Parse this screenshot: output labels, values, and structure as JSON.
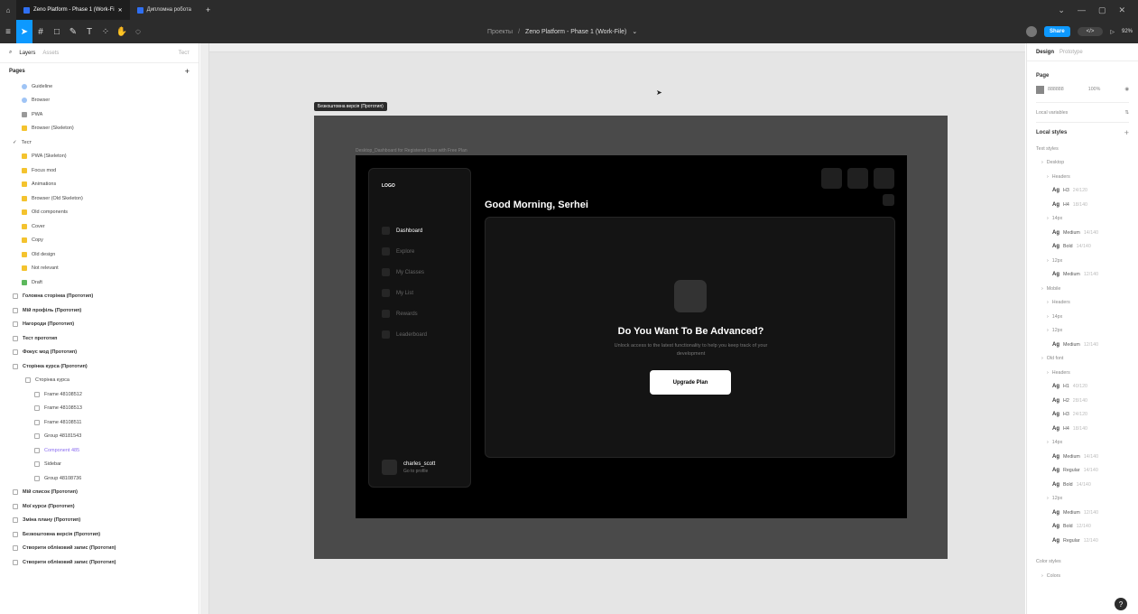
{
  "tabs": [
    "Zeno Platform - Phase 1 (Work-Fi",
    "Дипломна робота"
  ],
  "toolbar": {
    "breadcrumb_root": "Проекты",
    "breadcrumb_sep": "/",
    "file_name": "Zeno Platform - Phase 1 (Work-File)",
    "share": "Share",
    "zoom": "92%"
  },
  "left_panel": {
    "tab_layers": "Layers",
    "tab_assets": "Assets",
    "page_name": "Тест",
    "pages_title": "Pages",
    "add": "+",
    "items": [
      {
        "label": "Guideline",
        "icon": "blue"
      },
      {
        "label": "Browser",
        "icon": "blue"
      },
      {
        "label": "PWA",
        "icon": "gray"
      },
      {
        "label": "Browser (Skeleton)",
        "icon": "folder"
      },
      {
        "label": "Тест",
        "icon": "check"
      },
      {
        "label": "PWA (Skeleton)",
        "icon": "folder"
      },
      {
        "label": "Focus mod",
        "icon": "folder"
      },
      {
        "label": "Animations",
        "icon": "folder"
      },
      {
        "label": "Browser (Old Skeleton)",
        "icon": "folder"
      },
      {
        "label": "Old components",
        "icon": "folder"
      },
      {
        "label": "Cover",
        "icon": "folder"
      },
      {
        "label": "Copy",
        "icon": "folder"
      },
      {
        "label": "Old design",
        "icon": "folder"
      },
      {
        "label": "Not relevant",
        "icon": "folder"
      },
      {
        "label": "Draft",
        "icon": "green"
      },
      {
        "label": "Головна сторінка (Прототип)",
        "icon": "frame"
      },
      {
        "label": "Мій профіль (Прототип)",
        "icon": "frame"
      },
      {
        "label": "Нагороди (Прототип)",
        "icon": "frame"
      },
      {
        "label": "Тест прототип",
        "icon": "frame"
      },
      {
        "label": "Фокус мод (Прототип)",
        "icon": "frame"
      },
      {
        "label": "Сторінка курса (Прототип)",
        "icon": "frame"
      },
      {
        "label": "Сторінка курса",
        "icon": "frame"
      },
      {
        "label": "Frame 48108512",
        "icon": "frame"
      },
      {
        "label": "Frame 48108513",
        "icon": "frame"
      },
      {
        "label": "Frame 48108511",
        "icon": "frame"
      },
      {
        "label": "Group 48181543",
        "icon": "frame"
      },
      {
        "label": "Component 485",
        "icon": "frame"
      },
      {
        "label": "Sidebar",
        "icon": "frame"
      },
      {
        "label": "Group 48108736",
        "icon": "frame"
      },
      {
        "label": "Мій список (Прототип)",
        "icon": "frame"
      },
      {
        "label": "Мої курси (Прототип)",
        "icon": "frame"
      },
      {
        "label": "Зміна плану (Прототип)",
        "icon": "frame"
      },
      {
        "label": "Безкоштовна версія (Прототип)",
        "icon": "frame"
      },
      {
        "label": "Створити обліковий запис (Прототип)",
        "icon": "frame"
      },
      {
        "label": "Створити обліковий запис (Прототип)",
        "icon": "frame"
      }
    ]
  },
  "canvas": {
    "frame_label": "Безкоштовна версія (Прототип)",
    "inner_label": "Desktop_Dashboard for Registered User with Free Plan",
    "logo": "LOGO",
    "nav": [
      "Dashboard",
      "Explore",
      "My Classes",
      "My List",
      "Rewards",
      "Leaderboard"
    ],
    "greeting": "Good Morning, Serhei",
    "cta_title": "Do You Want To Be Advanced?",
    "cta_sub": "Unlock access to the latest functionality to help you keep track of your development",
    "cta_button": "Upgrade Plan",
    "user_name": "charles_scott",
    "user_sub": "Go to profile"
  },
  "right_panel": {
    "tab_design": "Design",
    "tab_prototype": "Prototype",
    "page_title": "Page",
    "page_color": "888888",
    "page_opacity": "100%",
    "local_variables": "Local variables",
    "local_styles": "Local styles",
    "text_styles": "Text styles",
    "rows": [
      {
        "label": "Desktop",
        "indent": 1
      },
      {
        "label": "Headers",
        "indent": 2
      },
      {
        "ag": "Ag",
        "label": "H3",
        "detail": "24/120",
        "indent": 3
      },
      {
        "ag": "Ag",
        "label": "H4",
        "detail": "18/140",
        "indent": 3
      },
      {
        "label": "14px",
        "indent": 2
      },
      {
        "ag": "Ag",
        "label": "Medium",
        "detail": "14/140",
        "indent": 3
      },
      {
        "ag": "Ag",
        "label": "Bold",
        "detail": "14/140",
        "indent": 3
      },
      {
        "label": "12px",
        "indent": 2
      },
      {
        "ag": "Ag",
        "label": "Medium",
        "detail": "12/140",
        "indent": 3
      },
      {
        "label": "Mobile",
        "indent": 1
      },
      {
        "label": "Headers",
        "indent": 2
      },
      {
        "label": "14px",
        "indent": 2
      },
      {
        "label": "12px",
        "indent": 2
      },
      {
        "ag": "Ag",
        "label": "Medium",
        "detail": "12/140",
        "indent": 3
      },
      {
        "label": "Old font",
        "indent": 1
      },
      {
        "label": "Headers",
        "indent": 2
      },
      {
        "ag": "Ag",
        "label": "H1",
        "detail": "40/120",
        "indent": 3
      },
      {
        "ag": "Ag",
        "label": "H2",
        "detail": "28/140",
        "indent": 3
      },
      {
        "ag": "Ag",
        "label": "H3",
        "detail": "24/120",
        "indent": 3
      },
      {
        "ag": "Ag",
        "label": "H4",
        "detail": "18/140",
        "indent": 3
      },
      {
        "label": "14px",
        "indent": 2
      },
      {
        "ag": "Ag",
        "label": "Medium",
        "detail": "14/140",
        "indent": 3
      },
      {
        "ag": "Ag",
        "label": "Regular",
        "detail": "14/140",
        "indent": 3
      },
      {
        "ag": "Ag",
        "label": "Bold",
        "detail": "14/140",
        "indent": 3
      },
      {
        "label": "12px",
        "indent": 2
      },
      {
        "ag": "Ag",
        "label": "Medium",
        "detail": "12/140",
        "indent": 3
      },
      {
        "ag": "Ag",
        "label": "Bold",
        "detail": "12/140",
        "indent": 3
      },
      {
        "ag": "Ag",
        "label": "Regular",
        "detail": "12/140",
        "indent": 3
      }
    ],
    "color_styles": "Color styles",
    "colors": "Colors"
  },
  "accent": "#0d99ff"
}
